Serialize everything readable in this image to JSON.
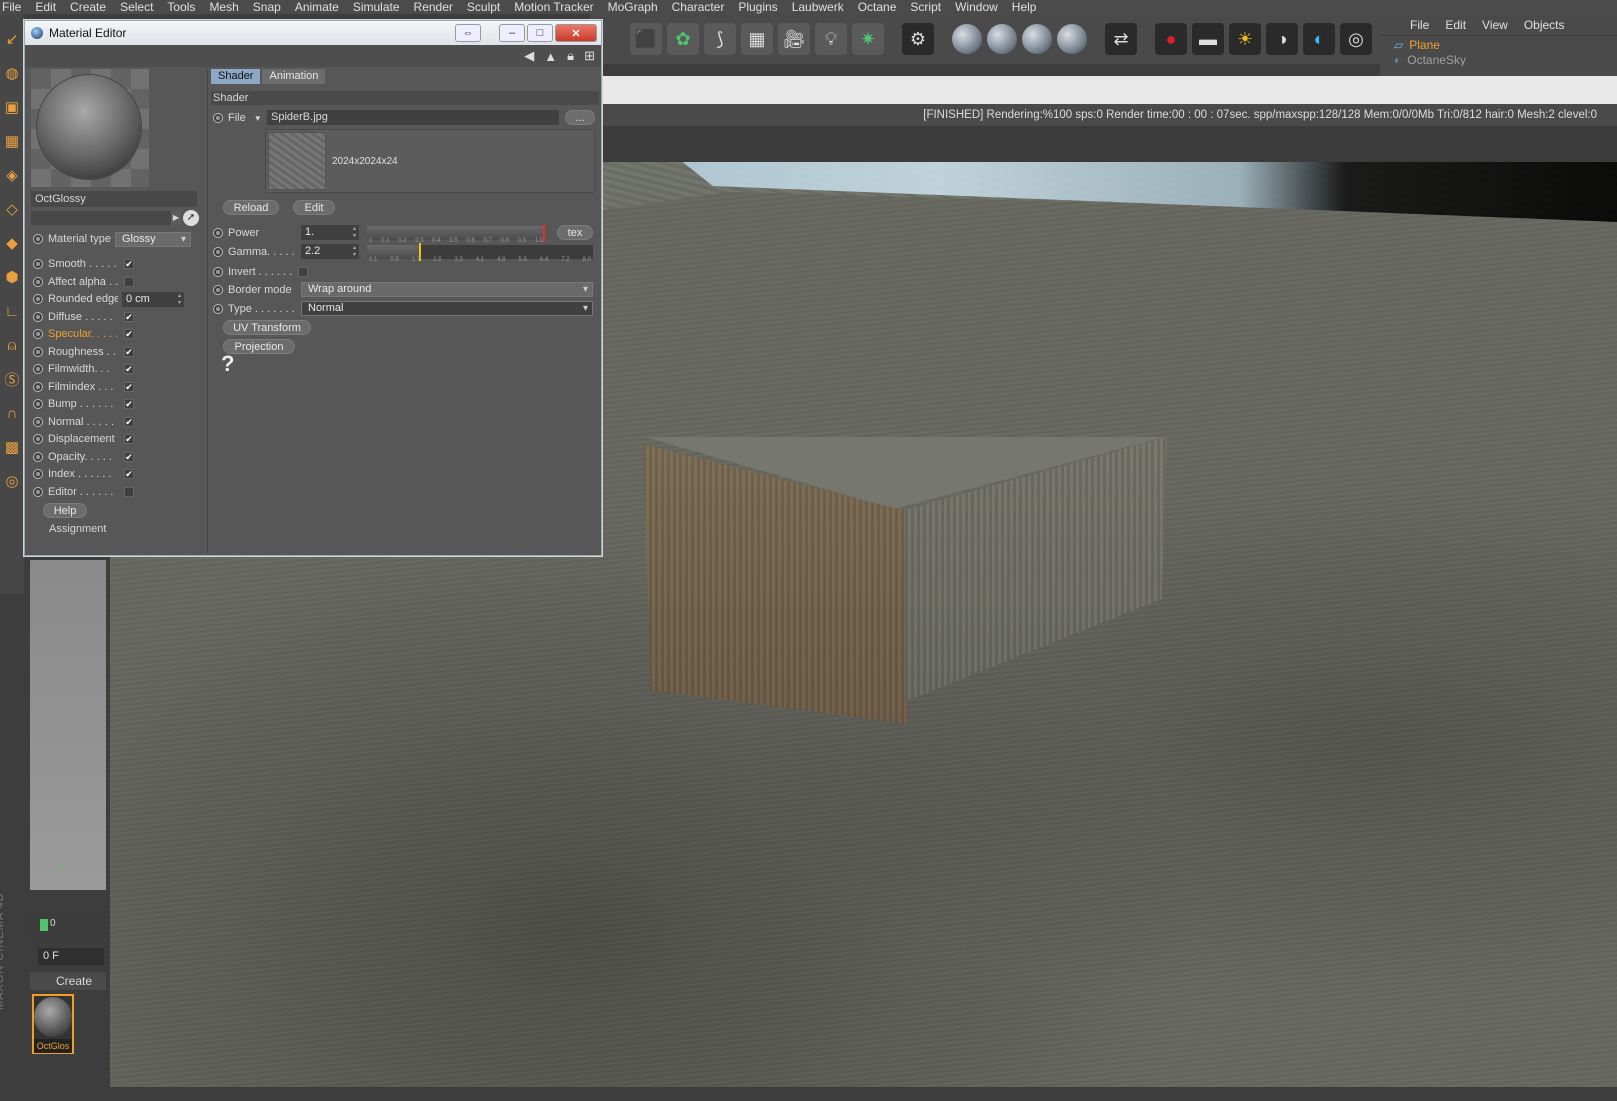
{
  "menubar": [
    "File",
    "Edit",
    "Create",
    "Select",
    "Tools",
    "Mesh",
    "Snap",
    "Animate",
    "Simulate",
    "Render",
    "Sculpt",
    "Motion Tracker",
    "MoGraph",
    "Character",
    "Plugins",
    "Laubwerk",
    "Octane",
    "Script",
    "Window",
    "Help"
  ],
  "toolbar": {
    "icons": [
      "cube-icon",
      "cloner-icon",
      "spline-icon",
      "floor-grid-icon",
      "camera-icon",
      "light-bulb-icon",
      "sun-burst-icon",
      "gear-icon",
      "sphere-material-icon",
      "sphere-glossy-icon",
      "sphere-specular-icon",
      "sphere-mix-icon",
      "shuffle-icon",
      "render-record-icon",
      "render-region-icon",
      "daylight-icon",
      "contrast-icon",
      "contrast-blue-icon",
      "target-icon"
    ]
  },
  "objects_panel": {
    "menu": [
      "File",
      "Edit",
      "View",
      "Objects"
    ],
    "rows": [
      {
        "name": "Plane"
      },
      {
        "name": "OctaneSky"
      }
    ]
  },
  "viewport": {
    "status": "[FINISHED]  Rendering:%100 sps:0 Render time:00 : 00 : 07sec. spp/maxspp:128/128 Mem:0/0/0Mb Tri:0/812 hair:0 Mesh:2 clevel:0"
  },
  "material_editor": {
    "title": "Material Editor",
    "material_name": "OctGlossy",
    "material_type_label": "Material type",
    "material_type_value": "Glossy",
    "channels": [
      {
        "label": "Smooth . . . . . .",
        "checked": true,
        "highlight": false
      },
      {
        "label": "Affect alpha . . .",
        "checked": false,
        "highlight": false
      },
      {
        "label": "Rounded edges",
        "checked": null,
        "value": "0 cm",
        "highlight": false
      },
      {
        "label": "Diffuse . . . . .",
        "checked": true,
        "highlight": false
      },
      {
        "label": "Specular. . . . .",
        "checked": true,
        "highlight": true
      },
      {
        "label": "Roughness . .",
        "checked": true,
        "highlight": false
      },
      {
        "label": "Filmwidth. . .",
        "checked": true,
        "highlight": false
      },
      {
        "label": "Filmindex . . .",
        "checked": true,
        "highlight": false
      },
      {
        "label": "Bump . . . . . .",
        "checked": true,
        "highlight": false
      },
      {
        "label": "Normal . . . . .",
        "checked": true,
        "highlight": false
      },
      {
        "label": "Displacement",
        "checked": true,
        "highlight": false
      },
      {
        "label": "Opacity. . . . .",
        "checked": true,
        "highlight": false
      },
      {
        "label": "Index . . . . . .",
        "checked": true,
        "highlight": false
      },
      {
        "label": "Editor . . . . . .",
        "checked": false,
        "highlight": false
      }
    ],
    "help_button": "Help",
    "assignment_label": "Assignment",
    "tabs": [
      "Shader",
      "Animation"
    ],
    "active_tab": "Shader",
    "section": "Shader",
    "file_label": "File",
    "file_value": "SpiderB.jpg",
    "file_browse": "...",
    "texture_resolution": "2024x2024x24",
    "reload_button": "Reload",
    "edit_button": "Edit",
    "power": {
      "label": "Power",
      "value": "1.",
      "level": 1.0,
      "ticks": [
        "0",
        "0.1",
        "0.2",
        "0.3",
        "0.4",
        "0.5",
        "0.6",
        "0.7",
        "0.8",
        "0.9",
        "1.0"
      ]
    },
    "tex_button": "tex",
    "gamma": {
      "label": "Gamma. . . . .",
      "value": "2.2",
      "level": 0.24,
      "ticks": [
        "0.1",
        "0.9",
        "1.7",
        "2.5",
        "3.3",
        "4.1",
        "4.9",
        "5.6",
        "6.4",
        "7.2",
        "8.0"
      ]
    },
    "invert": {
      "label": "Invert . . . . . .",
      "checked": false
    },
    "border_mode": {
      "label": "Border mode",
      "value": "Wrap around"
    },
    "type": {
      "label": "Type . . . . . . .",
      "value": "Normal"
    },
    "uv_transform_button": "UV Transform",
    "projection_button": "Projection",
    "help_symbol": "?"
  },
  "side": {
    "timeline_start": "0",
    "frame_value": "0 F",
    "create_menu": "Create",
    "material_thumb_label": "OctGlos",
    "brand": "MAXON CINEMA 4D"
  },
  "colors": {
    "accent": "#f0a030",
    "tab_active": "#8fa7c7",
    "background": "#3d3d3d"
  }
}
